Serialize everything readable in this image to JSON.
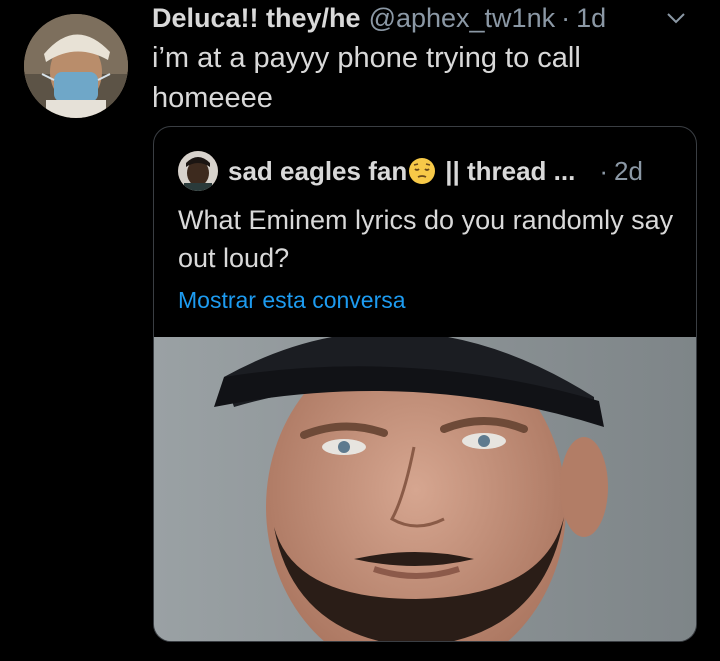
{
  "tweet": {
    "display_name": "Deluca!! they/he",
    "handle": "@aphex_tw1nk",
    "dot": "·",
    "time": "1d",
    "text": "i’m at a payyy phone trying to call homeeee"
  },
  "quoted": {
    "display_name": "sad eagles fan",
    "name_suffix": "|| thread ...",
    "dot": "·",
    "time": "2d",
    "text": "What Eminem lyrics do you randomly say out loud?",
    "show_conversation_link": "Mostrar esta conversa"
  },
  "icons": {
    "menu": "chevron-down-icon",
    "emoji": "pensive-face-emoji"
  },
  "colors": {
    "background": "#000000",
    "text": "#d9d9d9",
    "secondary": "#8b98a5",
    "link": "#1d9bf0",
    "border": "#3a3e43"
  }
}
